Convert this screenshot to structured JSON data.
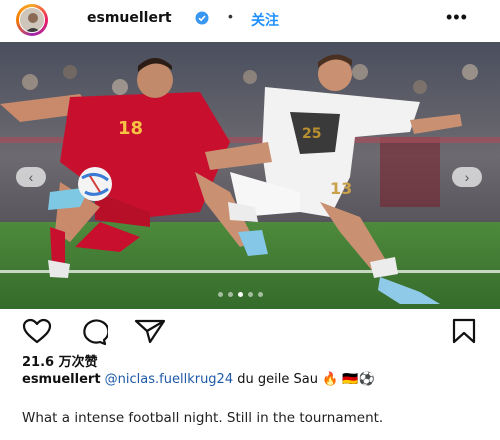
{
  "header": {
    "username": "esmuellert",
    "separator": "•",
    "follow_label": "关注",
    "more_label": "•••"
  },
  "post": {
    "carousel_prev": "‹",
    "carousel_next": "›",
    "slide_count": 5,
    "active_slide": 3
  },
  "actions": {
    "icons": [
      "heart-icon",
      "comment-icon",
      "share-icon",
      "bookmark-icon"
    ]
  },
  "likes": "21.6 万次赞",
  "caption": {
    "username": "esmuellert",
    "mention": "@niclas.fuellkrug24",
    "text": "du geile Sau",
    "emojis": "🔥 🇩🇪⚽"
  },
  "description": "What a intense football night. Still in the tournament.",
  "colors": {
    "accent_blue": "#1e90ff",
    "pitch_green": "#3f7d34",
    "spain_red": "#c8102e",
    "germany_white": "#f2f2f2"
  }
}
